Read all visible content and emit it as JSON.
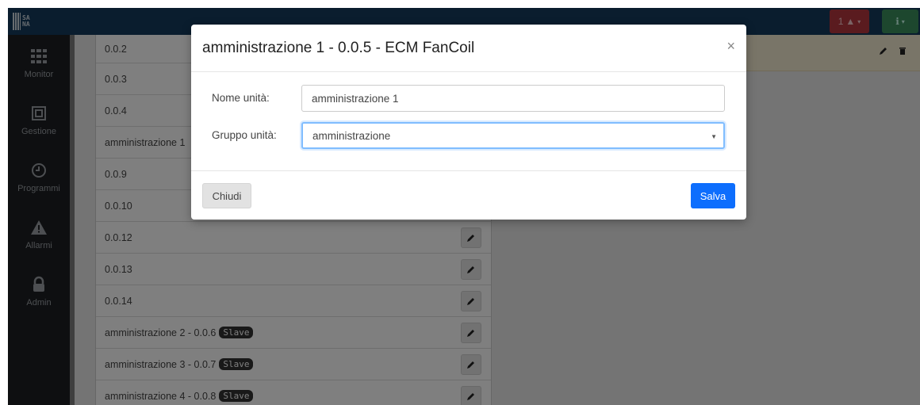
{
  "topbar": {
    "logo_text": "SA\nNA",
    "alarm_count": "1",
    "colors": {
      "bg": "#143a5c",
      "alarm": "#b5373f",
      "info": "#3a8f5c"
    }
  },
  "sidebar": {
    "items": [
      {
        "label": "Monitor",
        "icon": "grid-icon"
      },
      {
        "label": "Gestione",
        "icon": "layout-icon"
      },
      {
        "label": "Programmi",
        "icon": "clock-icon"
      },
      {
        "label": "Allarmi",
        "icon": "warning-icon"
      },
      {
        "label": "Admin",
        "icon": "lock-icon"
      }
    ]
  },
  "list": {
    "rows": [
      {
        "label": "0.0.2"
      },
      {
        "label": "0.0.3"
      },
      {
        "label": "0.0.4"
      },
      {
        "label": "amministrazione 1"
      },
      {
        "label": "0.0.9"
      },
      {
        "label": "0.0.10"
      },
      {
        "label": "0.0.12"
      },
      {
        "label": "0.0.13"
      },
      {
        "label": "0.0.14"
      },
      {
        "label": "amministrazione 2 - 0.0.6",
        "badge": "Slave"
      },
      {
        "label": "amministrazione 3 - 0.0.7",
        "badge": "Slave"
      },
      {
        "label": "amministrazione 4 - 0.0.8",
        "badge": "Slave"
      }
    ]
  },
  "modal": {
    "title": "amministrazione 1 - 0.0.5 - ECM FanCoil",
    "close_glyph": "×",
    "fields": {
      "name_label": "Nome unità:",
      "name_value": "amministrazione 1",
      "group_label": "Gruppo unità:",
      "group_value": "amministrazione"
    },
    "buttons": {
      "close": "Chiudi",
      "save": "Salva"
    }
  }
}
